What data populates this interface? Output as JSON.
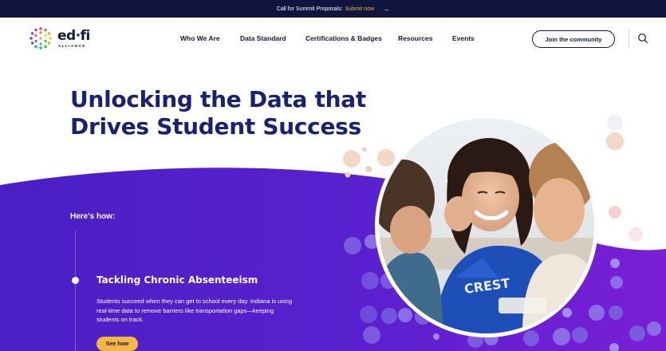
{
  "announcement": {
    "text": "Call for Summit Proposals:",
    "link_text": "Submit now",
    "arrow": "→"
  },
  "logo": {
    "word": "ed·fi",
    "sub": "ALLIANCE"
  },
  "nav": {
    "items": [
      {
        "label": "Who We Are"
      },
      {
        "label": "Data Standard"
      },
      {
        "label": "Certifications & Badges"
      },
      {
        "label": "Resources"
      },
      {
        "label": "Events"
      }
    ],
    "join_label": "Join the community",
    "search_icon": "search-icon"
  },
  "hero": {
    "title_line1": "Unlocking the Data that",
    "title_line2": "Drives Student Success"
  },
  "section": {
    "hows": "Here's how:",
    "card_title": "Tackling Chronic Absenteeism",
    "card_desc": "Students succeed when they can get to school every day. Indiana is using real-time data to remove barriers like transportation gaps—keeping students on track.",
    "see_how": "See how"
  },
  "colors": {
    "navy": "#12173f",
    "title_blue": "#1a2173",
    "accent_yellow": "#f4b740",
    "purple_left": "#4a1fc4",
    "purple_right": "#7a1fd6"
  }
}
